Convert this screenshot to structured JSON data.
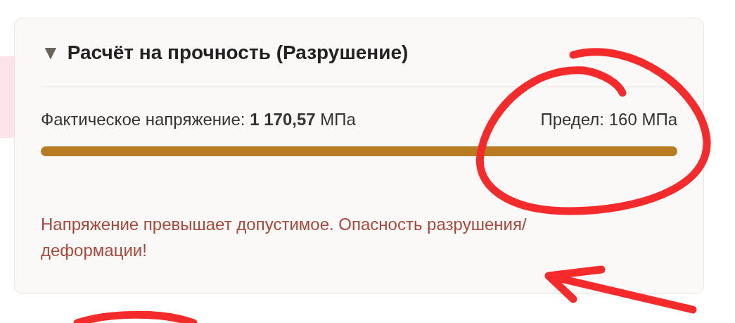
{
  "card": {
    "toggle": "▼",
    "title": "Расчёт на прочность (Разрушение)",
    "actual": "Фактическое напряжение: **1 170,57** МПа",
    "limit": "Предел: 160 МПа",
    "warning": "Напряжение превышает допустимое. Опасность разрушения/ деформации!"
  }
}
